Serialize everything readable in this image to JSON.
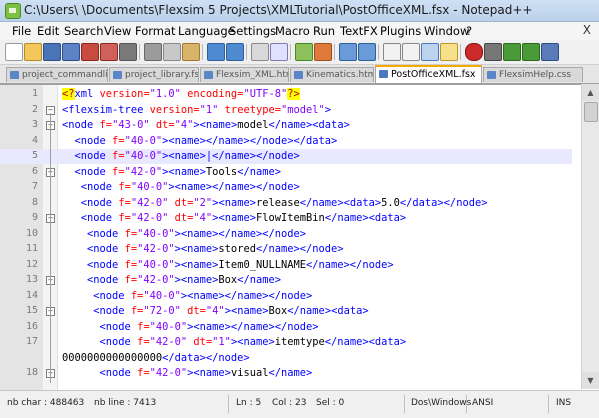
{
  "window": {
    "title": "C:\\Users\\          \\Documents\\Flexsim 5 Projects\\XMLTutorial\\PostOfficeXML.fsx - Notepad++"
  },
  "menu": [
    "File",
    "Edit",
    "Search",
    "View",
    "Format",
    "Language",
    "Settings",
    "Macro",
    "Run",
    "TextFX",
    "Plugins",
    "Window",
    "?"
  ],
  "menu_close": "X",
  "tabs": [
    {
      "label": "project_commandlist.fsx",
      "active": false
    },
    {
      "label": "project_library.fsx",
      "active": false
    },
    {
      "label": "Flexsim_XML.html",
      "active": false
    },
    {
      "label": "Kinematics.html",
      "active": false
    },
    {
      "label": "PostOfficeXML.fsx",
      "active": true
    },
    {
      "label": "FlexsimHelp.css",
      "active": false
    }
  ],
  "lines": [
    {
      "n": "1",
      "parts": [
        {
          "t": "<?",
          "c": "#c00000",
          "bg": "#ffff00"
        },
        {
          "t": "xml ",
          "c": "#0000ff"
        },
        {
          "t": "version=",
          "c": "#ff0000"
        },
        {
          "t": "\"1.0\"",
          "c": "#8000ff"
        },
        {
          "t": " encoding=",
          "c": "#ff0000"
        },
        {
          "t": "\"UTF-8\"",
          "c": "#8000ff"
        },
        {
          "t": "?>",
          "c": "#c00000",
          "bg": "#ffff00"
        }
      ]
    },
    {
      "n": "2",
      "parts": [
        {
          "t": "<flexsim-tree ",
          "c": "#0000ff"
        },
        {
          "t": "version=",
          "c": "#ff0000"
        },
        {
          "t": "\"1\"",
          "c": "#8000ff"
        },
        {
          "t": " treetype=",
          "c": "#ff0000"
        },
        {
          "t": "\"model\"",
          "c": "#8000ff"
        },
        {
          "t": ">",
          "c": "#0000ff"
        }
      ]
    },
    {
      "n": "3",
      "parts": [
        {
          "t": "<node ",
          "c": "#0000ff"
        },
        {
          "t": "f=",
          "c": "#ff0000"
        },
        {
          "t": "\"43-0\"",
          "c": "#8000ff"
        },
        {
          "t": " dt=",
          "c": "#ff0000"
        },
        {
          "t": "\"4\"",
          "c": "#8000ff"
        },
        {
          "t": "><name>",
          "c": "#0000ff"
        },
        {
          "t": "model",
          "c": "#000000"
        },
        {
          "t": "</name><data>",
          "c": "#0000ff"
        }
      ]
    },
    {
      "n": "4",
      "parts": [
        {
          "t": "  <node ",
          "c": "#0000ff"
        },
        {
          "t": "f=",
          "c": "#ff0000"
        },
        {
          "t": "\"40-0\"",
          "c": "#8000ff"
        },
        {
          "t": "><name></name></node></data>",
          "c": "#0000ff"
        }
      ]
    },
    {
      "n": "5",
      "parts": [
        {
          "t": "  <node ",
          "c": "#0000ff"
        },
        {
          "t": "f=",
          "c": "#ff0000"
        },
        {
          "t": "\"40-0\"",
          "c": "#8000ff"
        },
        {
          "t": "><name>|</name></node>",
          "c": "#0000ff"
        }
      ],
      "current": true
    },
    {
      "n": "6",
      "parts": [
        {
          "t": "  <node ",
          "c": "#0000ff"
        },
        {
          "t": "f=",
          "c": "#ff0000"
        },
        {
          "t": "\"42-0\"",
          "c": "#8000ff"
        },
        {
          "t": "><name>",
          "c": "#0000ff"
        },
        {
          "t": "Tools",
          "c": "#000000"
        },
        {
          "t": "</name>",
          "c": "#0000ff"
        }
      ]
    },
    {
      "n": "7",
      "parts": [
        {
          "t": "   <node ",
          "c": "#0000ff"
        },
        {
          "t": "f=",
          "c": "#ff0000"
        },
        {
          "t": "\"40-0\"",
          "c": "#8000ff"
        },
        {
          "t": "><name></name></node>",
          "c": "#0000ff"
        }
      ]
    },
    {
      "n": "8",
      "parts": [
        {
          "t": "   <node ",
          "c": "#0000ff"
        },
        {
          "t": "f=",
          "c": "#ff0000"
        },
        {
          "t": "\"42-0\"",
          "c": "#8000ff"
        },
        {
          "t": " dt=",
          "c": "#ff0000"
        },
        {
          "t": "\"2\"",
          "c": "#8000ff"
        },
        {
          "t": "><name>",
          "c": "#0000ff"
        },
        {
          "t": "release",
          "c": "#000000"
        },
        {
          "t": "</name><data>",
          "c": "#0000ff"
        },
        {
          "t": "5.0",
          "c": "#000000"
        },
        {
          "t": "</data></node>",
          "c": "#0000ff"
        }
      ]
    },
    {
      "n": "9",
      "parts": [
        {
          "t": "   <node ",
          "c": "#0000ff"
        },
        {
          "t": "f=",
          "c": "#ff0000"
        },
        {
          "t": "\"42-0\"",
          "c": "#8000ff"
        },
        {
          "t": " dt=",
          "c": "#ff0000"
        },
        {
          "t": "\"4\"",
          "c": "#8000ff"
        },
        {
          "t": "><name>",
          "c": "#0000ff"
        },
        {
          "t": "FlowItemBin",
          "c": "#000000"
        },
        {
          "t": "</name><data>",
          "c": "#0000ff"
        }
      ]
    },
    {
      "n": "10",
      "parts": [
        {
          "t": "    <node ",
          "c": "#0000ff"
        },
        {
          "t": "f=",
          "c": "#ff0000"
        },
        {
          "t": "\"40-0\"",
          "c": "#8000ff"
        },
        {
          "t": "><name></name></node>",
          "c": "#0000ff"
        }
      ]
    },
    {
      "n": "11",
      "parts": [
        {
          "t": "    <node ",
          "c": "#0000ff"
        },
        {
          "t": "f=",
          "c": "#ff0000"
        },
        {
          "t": "\"42-0\"",
          "c": "#8000ff"
        },
        {
          "t": "><name>",
          "c": "#0000ff"
        },
        {
          "t": "stored",
          "c": "#000000"
        },
        {
          "t": "</name></node>",
          "c": "#0000ff"
        }
      ]
    },
    {
      "n": "12",
      "parts": [
        {
          "t": "    <node ",
          "c": "#0000ff"
        },
        {
          "t": "f=",
          "c": "#ff0000"
        },
        {
          "t": "\"40-0\"",
          "c": "#8000ff"
        },
        {
          "t": "><name>",
          "c": "#0000ff"
        },
        {
          "t": "Item0_NULLNAME",
          "c": "#000000"
        },
        {
          "t": "</name></node>",
          "c": "#0000ff"
        }
      ]
    },
    {
      "n": "13",
      "parts": [
        {
          "t": "    <node ",
          "c": "#0000ff"
        },
        {
          "t": "f=",
          "c": "#ff0000"
        },
        {
          "t": "\"42-0\"",
          "c": "#8000ff"
        },
        {
          "t": "><name>",
          "c": "#0000ff"
        },
        {
          "t": "Box",
          "c": "#000000"
        },
        {
          "t": "</name>",
          "c": "#0000ff"
        }
      ]
    },
    {
      "n": "14",
      "parts": [
        {
          "t": "     <node ",
          "c": "#0000ff"
        },
        {
          "t": "f=",
          "c": "#ff0000"
        },
        {
          "t": "\"40-0\"",
          "c": "#8000ff"
        },
        {
          "t": "><name></name></node>",
          "c": "#0000ff"
        }
      ]
    },
    {
      "n": "15",
      "parts": [
        {
          "t": "     <node ",
          "c": "#0000ff"
        },
        {
          "t": "f=",
          "c": "#ff0000"
        },
        {
          "t": "\"72-0\"",
          "c": "#8000ff"
        },
        {
          "t": " dt=",
          "c": "#ff0000"
        },
        {
          "t": "\"4\"",
          "c": "#8000ff"
        },
        {
          "t": "><name>",
          "c": "#0000ff"
        },
        {
          "t": "Box",
          "c": "#000000"
        },
        {
          "t": "</name><data>",
          "c": "#0000ff"
        }
      ]
    },
    {
      "n": "16",
      "parts": [
        {
          "t": "      <node ",
          "c": "#0000ff"
        },
        {
          "t": "f=",
          "c": "#ff0000"
        },
        {
          "t": "\"40-0\"",
          "c": "#8000ff"
        },
        {
          "t": "><name></name></node>",
          "c": "#0000ff"
        }
      ]
    },
    {
      "n": "17",
      "parts": [
        {
          "t": "      <node ",
          "c": "#0000ff"
        },
        {
          "t": "f=",
          "c": "#ff0000"
        },
        {
          "t": "\"42-0\"",
          "c": "#8000ff"
        },
        {
          "t": " dt=",
          "c": "#ff0000"
        },
        {
          "t": "\"1\"",
          "c": "#8000ff"
        },
        {
          "t": "><name>",
          "c": "#0000ff"
        },
        {
          "t": "itemtype",
          "c": "#000000"
        },
        {
          "t": "</name><data>",
          "c": "#0000ff"
        }
      ]
    },
    {
      "n": "",
      "parts": [
        {
          "t": "0000000000000000",
          "c": "#000000"
        },
        {
          "t": "</data></node>",
          "c": "#0000ff"
        }
      ]
    },
    {
      "n": "18",
      "parts": [
        {
          "t": "      <node ",
          "c": "#0000ff"
        },
        {
          "t": "f=",
          "c": "#ff0000"
        },
        {
          "t": "\"42-0\"",
          "c": "#8000ff"
        },
        {
          "t": "><name>",
          "c": "#0000ff"
        },
        {
          "t": "visual",
          "c": "#000000"
        },
        {
          "t": "</name>",
          "c": "#0000ff"
        }
      ]
    }
  ],
  "status": {
    "chars": "nb char : 488463",
    "lines": "nb line : 7413",
    "ln": "Ln : 5",
    "col": "Col : 23",
    "sel": "Sel : 0",
    "eol": "Dos\\Windows",
    "encoding": "ANSI",
    "mode": "INS"
  }
}
